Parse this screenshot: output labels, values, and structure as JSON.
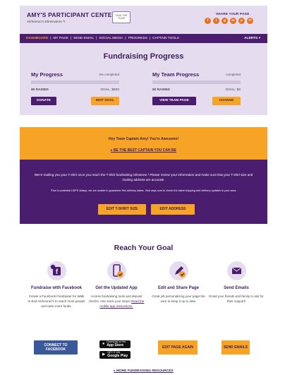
{
  "header": {
    "brand_title": "AMY'S PARTICIPANT CENTER",
    "tour_label": "TAKE THE TOUR",
    "subtitle": "Alzheimer's Eliminators ✎",
    "share_label": "SHARE YOUR PAGE",
    "share_icons": [
      "facebook-icon",
      "twitter-icon",
      "google-plus-icon",
      "linkedin-icon",
      "pinterest-icon",
      "email-icon"
    ],
    "share_glyphs": [
      "f",
      "t",
      "g",
      "in",
      "p",
      "✉"
    ]
  },
  "nav": {
    "items": [
      "DASHBOARD",
      "MY PAGE",
      "SEND EMAIL",
      "SOCIAL MEDIA",
      "PROGRESS",
      "CAPTAIN TOOLS"
    ],
    "active_index": 0,
    "alerts_label": "ALERTS ▾"
  },
  "progress": {
    "title": "Fundraising Progress",
    "my": {
      "title": "My Progress",
      "status": "0% completed",
      "fraction": 0,
      "raised": "$0 RAISED",
      "goal": "GOAL: $500",
      "btn1": "DONATE",
      "btn2": "EDIT GOAL"
    },
    "team": {
      "title": "My Team Progress",
      "status": "completed",
      "fraction": 0,
      "raised": "$0 RAISED",
      "goal": "GOAL: $0",
      "btn1": "VIEW TEAM PAGE",
      "btn2": "CHANGE"
    }
  },
  "captain": {
    "message": "Hey Team Captain Amy! You're Awesome!",
    "link": "▸  BE THE BEST CAPTAIN YOU CAN BE"
  },
  "tshirt": {
    "message": "We're mailing you your T-shirt once you reach the T-shirt fundraising milestone.* Please review your information and make sure that your T-shirt size and mailing address are accurate.",
    "note": "*Due to potential USPS delays, we are unable to guarantee firm delivery dates. Visit usps.com to check the latest shipping and delivery updates in your area.",
    "btn_size": "EDIT T-SHIRT SIZE",
    "btn_address": "EDIT ADDRESS"
  },
  "reach": {
    "title": "Reach Your Goal",
    "cols": [
      {
        "head": "Fundraise with Facebook",
        "body": "Create a Facebook Fundraiser for Walk to End Alzheimer's to reach more people and raise more funds.",
        "button": "CONNECT TO FACEBOOK"
      },
      {
        "head": "Get the Updated App",
        "body": "Access fundraising tools and deposit checks. Also track your steps! ",
        "link": "Read the mobile app instructions.",
        "app_store_top": "Download on the",
        "app_store": "App Store",
        "google_play_top": "GET IT ON",
        "google_play": "Google Play"
      },
      {
        "head": "Edit and Share Page",
        "body": "Great job personalizing your page! Be sure to keep it up to date.",
        "button": "EDIT PAGE AGAIN"
      },
      {
        "head": "Send Emails",
        "body": "Email your friends and family to ask for their support!",
        "button": "SEND EMAILS"
      }
    ],
    "more_link": "▸  MORE FUNDRAISING RESOURCES"
  },
  "colors": {
    "purple": "#4b1d6e",
    "lavender": "#e6dcf0",
    "orange": "#f7a325",
    "facebook": "#3b5998"
  }
}
